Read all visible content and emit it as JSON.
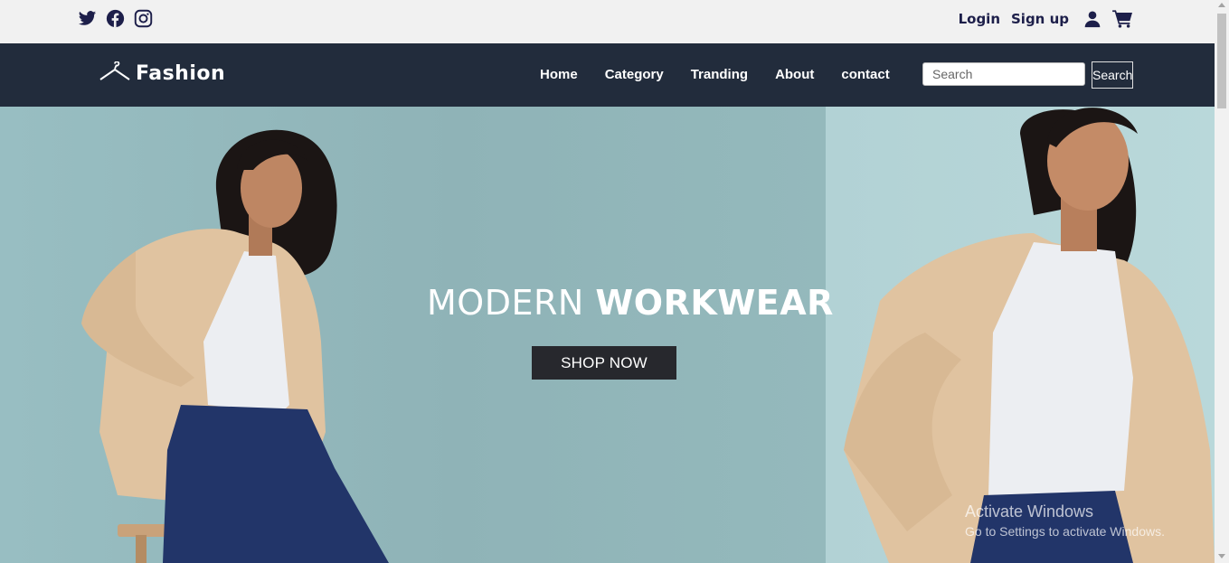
{
  "topbar": {
    "social": [
      {
        "icon": "twitter-icon"
      },
      {
        "icon": "facebook-icon"
      },
      {
        "icon": "instagram-icon"
      }
    ],
    "login_label": "Login",
    "signup_label": "Sign up",
    "user_icon": "user-icon",
    "cart_icon": "cart-icon"
  },
  "navbar": {
    "brand": "Fashion",
    "logo_icon": "hanger-icon",
    "links": [
      "Home",
      "Category",
      "Tranding",
      "About",
      "contact"
    ],
    "search": {
      "placeholder": "Search",
      "button_label": "Search"
    }
  },
  "hero": {
    "title_light": "MODERN",
    "title_bold": "WORKWEAR",
    "cta_label": "SHOP NOW"
  },
  "watermark": {
    "line1": "Activate Windows",
    "line2": "Go to Settings to activate Windows."
  },
  "colors": {
    "navbar_bg": "#222c3c",
    "topbar_bg": "#f1f1f1",
    "accent_text": "#1d1f4a",
    "cta_bg": "#27282d",
    "hero_bg": "#9ab9bc"
  }
}
